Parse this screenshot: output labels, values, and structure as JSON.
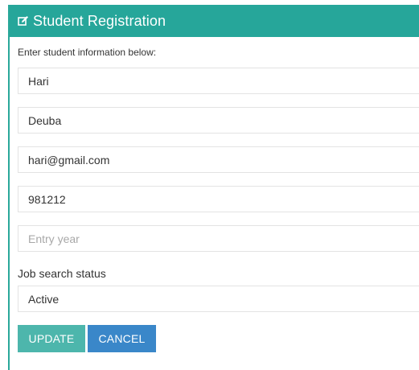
{
  "header": {
    "icon": "edit-icon",
    "title": "Student Registration"
  },
  "form": {
    "subtitle": "Enter student information below:",
    "fields": [
      {
        "value": "Hari",
        "placeholder": ""
      },
      {
        "value": "Deuba",
        "placeholder": ""
      },
      {
        "value": "hari@gmail.com",
        "placeholder": ""
      },
      {
        "value": "981212",
        "placeholder": ""
      },
      {
        "value": "",
        "placeholder": "Entry year"
      }
    ],
    "job_status_label": "Job search status",
    "job_status_value": "Active"
  },
  "buttons": {
    "update_label": "UPDATE",
    "cancel_label": "CANCEL"
  },
  "colors": {
    "header_bg": "#26a69a",
    "update_bg": "#4db6ac",
    "cancel_bg": "#3a87c9"
  }
}
